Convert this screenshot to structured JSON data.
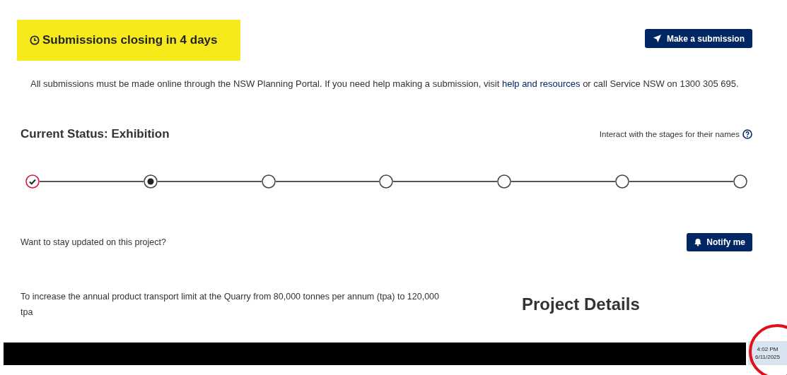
{
  "banner": {
    "title": "Submissions closing in 4 days"
  },
  "submit_button": {
    "label": "Make a submission"
  },
  "notice": {
    "text_before": "All submissions must be made online through the NSW Planning Portal. If you need help making a submission, visit ",
    "link": "help and resources",
    "text_after": " or call Service NSW on 1300 305 695."
  },
  "status": {
    "title": "Current Status: Exhibition",
    "hint": "Interact with the stages for their names"
  },
  "stages": [
    {
      "kind": "done"
    },
    {
      "kind": "current"
    },
    {
      "kind": "upcoming"
    },
    {
      "kind": "upcoming"
    },
    {
      "kind": "upcoming"
    },
    {
      "kind": "upcoming"
    },
    {
      "kind": "upcoming"
    }
  ],
  "updates": {
    "prompt": "Want to stay updated on this project?",
    "button": "Notify me"
  },
  "description": "To increase the annual product transport limit at the Quarry from 80,000 tonnes per annum (tpa) to 120,000 tpa",
  "project_details": {
    "title": "Project Details"
  },
  "taskbar": {
    "time": "4:02 PM",
    "date": "6/11/2025"
  }
}
